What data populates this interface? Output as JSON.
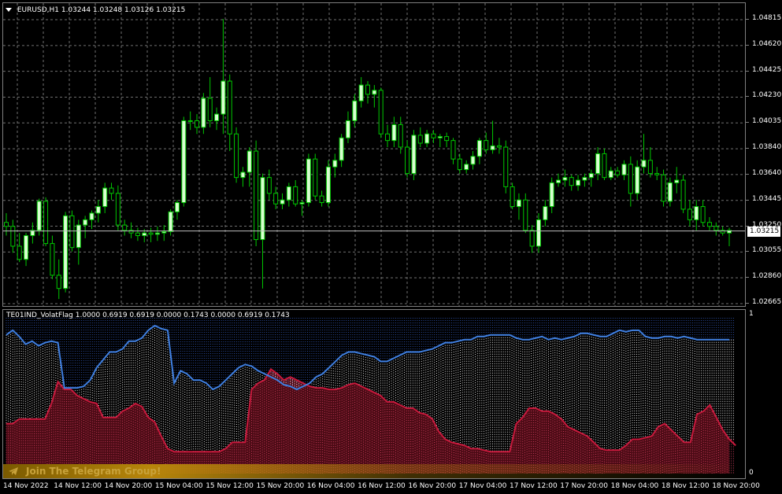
{
  "header": {
    "symbol_label": "EURUSD,H1  1.03244 1.03248 1.03126 1.03215",
    "arrow_icon": "triangle-down-icon"
  },
  "indicator": {
    "label": "TE01IND_VolatFlag 1.0000 0.6919 0.6919 0.0000 0.1743 0.0000 0.6919 0.1743",
    "scale_top": "1",
    "scale_bottom": "0",
    "colors": {
      "upper_line": "#3f7fe0",
      "lower_line": "#c8193c",
      "lower_fill": "#4a0a14",
      "dots_upper": "#2a4a9a",
      "dots_lower": "#d04060"
    }
  },
  "price_axis": {
    "labels": [
      "1.04815",
      "1.04620",
      "1.04425",
      "1.04230",
      "1.04035",
      "1.03840",
      "1.03640",
      "1.03445",
      "1.03250",
      "1.03055",
      "1.02860",
      "1.02665"
    ],
    "current_price": "1.03215"
  },
  "time_axis": {
    "labels": [
      "14 Nov 2022",
      "14 Nov 12:00",
      "14 Nov 20:00",
      "15 Nov 04:00",
      "15 Nov 12:00",
      "15 Nov 20:00",
      "16 Nov 04:00",
      "16 Nov 12:00",
      "16 Nov 20:00",
      "17 Nov 04:00",
      "17 Nov 12:00",
      "17 Nov 20:00",
      "18 Nov 04:00",
      "18 Nov 12:00",
      "18 Nov 20:00"
    ]
  },
  "banner": {
    "text": "Join The Telegram Group!",
    "icon": "telegram-icon"
  },
  "colors": {
    "background": "#000000",
    "candle": "#00c800",
    "candle_bull_body": "#d8ffd0",
    "grid": "#6f6f6f"
  },
  "chart_data": [
    {
      "type": "candlestick",
      "symbol": "EURUSD,H1",
      "ylim": [
        1.02665,
        1.04815
      ],
      "bars": [
        [
          1.0328,
          1.0335,
          1.0318,
          1.0325
        ],
        [
          1.0325,
          1.033,
          1.0305,
          1.031
        ],
        [
          1.031,
          1.032,
          1.0298,
          1.03
        ],
        [
          1.03,
          1.032,
          1.0295,
          1.0318
        ],
        [
          1.0318,
          1.0328,
          1.0312,
          1.0322
        ],
        [
          1.0322,
          1.0346,
          1.0318,
          1.0344
        ],
        [
          1.0344,
          1.0347,
          1.031,
          1.0312
        ],
        [
          1.0312,
          1.0318,
          1.0285,
          1.0288
        ],
        [
          1.0288,
          1.03,
          1.027,
          1.0278
        ],
        [
          1.0278,
          1.0336,
          1.0275,
          1.0333
        ],
        [
          1.0333,
          1.0337,
          1.0306,
          1.0309
        ],
        [
          1.0309,
          1.033,
          1.0296,
          1.0326
        ],
        [
          1.0326,
          1.0333,
          1.0316,
          1.033
        ],
        [
          1.033,
          1.0337,
          1.0323,
          1.0335
        ],
        [
          1.0335,
          1.0345,
          1.0328,
          1.034
        ],
        [
          1.034,
          1.0358,
          1.0335,
          1.0354
        ],
        [
          1.0354,
          1.0358,
          1.0345,
          1.035
        ],
        [
          1.035,
          1.0356,
          1.0322,
          1.0326
        ],
        [
          1.0326,
          1.033,
          1.0318,
          1.0322
        ],
        [
          1.0322,
          1.0328,
          1.0316,
          1.032
        ],
        [
          1.032,
          1.0324,
          1.0314,
          1.0318
        ],
        [
          1.0318,
          1.0323,
          1.0313,
          1.032
        ],
        [
          1.032,
          1.0324,
          1.0313,
          1.0319
        ],
        [
          1.0319,
          1.0325,
          1.0314,
          1.032
        ],
        [
          1.032,
          1.0326,
          1.0314,
          1.0321
        ],
        [
          1.0321,
          1.0338,
          1.0318,
          1.0336
        ],
        [
          1.0336,
          1.0345,
          1.033,
          1.0343
        ],
        [
          1.0343,
          1.0408,
          1.034,
          1.0405
        ],
        [
          1.0405,
          1.0412,
          1.0398,
          1.0405
        ],
        [
          1.0405,
          1.041,
          1.0395,
          1.04
        ],
        [
          1.04,
          1.0426,
          1.0395,
          1.0422
        ],
        [
          1.0422,
          1.0438,
          1.04,
          1.0405
        ],
        [
          1.0405,
          1.0415,
          1.0398,
          1.041
        ],
        [
          1.041,
          1.0482,
          1.0395,
          1.0435
        ],
        [
          1.0435,
          1.044,
          1.0382,
          1.0395
        ],
        [
          1.0395,
          1.04,
          1.0358,
          1.0362
        ],
        [
          1.0362,
          1.037,
          1.0355,
          1.0366
        ],
        [
          1.0366,
          1.0385,
          1.0355,
          1.0382
        ],
        [
          1.0382,
          1.039,
          1.031,
          1.0315
        ],
        [
          1.0315,
          1.0365,
          1.0278,
          1.0362
        ],
        [
          1.0362,
          1.0368,
          1.0345,
          1.035
        ],
        [
          1.035,
          1.0355,
          1.0338,
          1.0342
        ],
        [
          1.0342,
          1.035,
          1.0338,
          1.0345
        ],
        [
          1.0345,
          1.0358,
          1.034,
          1.0355
        ],
        [
          1.0355,
          1.036,
          1.034,
          1.0342
        ],
        [
          1.0342,
          1.0345,
          1.0333,
          1.0343
        ],
        [
          1.0343,
          1.038,
          1.034,
          1.0376
        ],
        [
          1.0376,
          1.038,
          1.0345,
          1.0348
        ],
        [
          1.0348,
          1.0352,
          1.034,
          1.0343
        ],
        [
          1.0343,
          1.0375,
          1.034,
          1.037
        ],
        [
          1.037,
          1.038,
          1.0362,
          1.0375
        ],
        [
          1.0375,
          1.0395,
          1.037,
          1.0392
        ],
        [
          1.0392,
          1.0412,
          1.0388,
          1.0405
        ],
        [
          1.0405,
          1.0425,
          1.04,
          1.042
        ],
        [
          1.042,
          1.0438,
          1.0415,
          1.0432
        ],
        [
          1.0432,
          1.0435,
          1.0418,
          1.0425
        ],
        [
          1.0425,
          1.0432,
          1.0415,
          1.0428
        ],
        [
          1.0428,
          1.043,
          1.0392,
          1.0395
        ],
        [
          1.0395,
          1.0402,
          1.0385,
          1.039
        ],
        [
          1.039,
          1.0408,
          1.0385,
          1.0402
        ],
        [
          1.0402,
          1.0408,
          1.038,
          1.0385
        ],
        [
          1.0385,
          1.039,
          1.0362,
          1.0365
        ],
        [
          1.0365,
          1.0398,
          1.036,
          1.0394
        ],
        [
          1.0394,
          1.04,
          1.0385,
          1.0388
        ],
        [
          1.0388,
          1.0398,
          1.0385,
          1.0395
        ],
        [
          1.0395,
          1.0398,
          1.0388,
          1.0392
        ],
        [
          1.0392,
          1.0395,
          1.0385,
          1.0393
        ],
        [
          1.0393,
          1.0396,
          1.0385,
          1.039
        ],
        [
          1.039,
          1.0392,
          1.0372,
          1.0376
        ],
        [
          1.0376,
          1.038,
          1.0365,
          1.0368
        ],
        [
          1.0368,
          1.0375,
          1.0365,
          1.0372
        ],
        [
          1.0372,
          1.0382,
          1.0368,
          1.0378
        ],
        [
          1.0378,
          1.0392,
          1.0372,
          1.039
        ],
        [
          1.039,
          1.0396,
          1.038,
          1.0383
        ],
        [
          1.0383,
          1.0405,
          1.038,
          1.0386
        ],
        [
          1.0386,
          1.0392,
          1.038,
          1.0385
        ],
        [
          1.0385,
          1.039,
          1.035,
          1.0355
        ],
        [
          1.0355,
          1.0358,
          1.0338,
          1.034
        ],
        [
          1.034,
          1.035,
          1.033,
          1.0345
        ],
        [
          1.0345,
          1.035,
          1.032,
          1.0322
        ],
        [
          1.0322,
          1.0326,
          1.0305,
          1.031
        ],
        [
          1.031,
          1.0335,
          1.0305,
          1.033
        ],
        [
          1.033,
          1.0345,
          1.0325,
          1.034
        ],
        [
          1.034,
          1.0362,
          1.0335,
          1.0358
        ],
        [
          1.0358,
          1.0365,
          1.0355,
          1.036
        ],
        [
          1.036,
          1.0368,
          1.0355,
          1.0362
        ],
        [
          1.0362,
          1.0364,
          1.0352,
          1.0356
        ],
        [
          1.0356,
          1.0364,
          1.0352,
          1.036
        ],
        [
          1.036,
          1.0365,
          1.0355,
          1.0362
        ],
        [
          1.0362,
          1.0368,
          1.0355,
          1.0365
        ],
        [
          1.0365,
          1.0385,
          1.036,
          1.038
        ],
        [
          1.038,
          1.0384,
          1.036,
          1.0362
        ],
        [
          1.0362,
          1.037,
          1.036,
          1.0367
        ],
        [
          1.0367,
          1.037,
          1.0362,
          1.0364
        ],
        [
          1.0364,
          1.0375,
          1.036,
          1.0372
        ],
        [
          1.0372,
          1.0378,
          1.034,
          1.035
        ],
        [
          1.035,
          1.0375,
          1.0345,
          1.037
        ],
        [
          1.037,
          1.0395,
          1.0365,
          1.0375
        ],
        [
          1.0375,
          1.0385,
          1.0362,
          1.0365
        ],
        [
          1.0365,
          1.037,
          1.036,
          1.0364
        ],
        [
          1.0364,
          1.0368,
          1.034,
          1.0344
        ],
        [
          1.0344,
          1.0362,
          1.034,
          1.0358
        ],
        [
          1.0358,
          1.037,
          1.035,
          1.036
        ],
        [
          1.036,
          1.0364,
          1.0335,
          1.0338
        ],
        [
          1.0338,
          1.0345,
          1.0325,
          1.033
        ],
        [
          1.033,
          1.0345,
          1.0322,
          1.034
        ],
        [
          1.034,
          1.0345,
          1.0325,
          1.0328
        ],
        [
          1.0328,
          1.0332,
          1.0322,
          1.0325
        ],
        [
          1.0325,
          1.0328,
          1.0318,
          1.0322
        ],
        [
          1.0322,
          1.0325,
          1.0318,
          1.032
        ],
        [
          1.032,
          1.0324,
          1.031,
          1.0322
        ]
      ]
    },
    {
      "type": "line",
      "name": "TE01IND_VolatFlag",
      "ylim": [
        0,
        1
      ],
      "series": [
        {
          "values": [
            0.89,
            0.92,
            0.88,
            0.83,
            0.85,
            0.82,
            0.84,
            0.85,
            0.84,
            0.55,
            0.55,
            0.55,
            0.56,
            0.6,
            0.68,
            0.73,
            0.78,
            0.78,
            0.8,
            0.85,
            0.85,
            0.87,
            0.92,
            0.95,
            0.93,
            0.92,
            0.58,
            0.66,
            0.64,
            0.6,
            0.6,
            0.58,
            0.54,
            0.56,
            0.6,
            0.64,
            0.68,
            0.7,
            0.69,
            0.66,
            0.64,
            0.62,
            0.6,
            0.57,
            0.56,
            0.54,
            0.56,
            0.58,
            0.62,
            0.64,
            0.68,
            0.72,
            0.76,
            0.78,
            0.78,
            0.77,
            0.76,
            0.75,
            0.72,
            0.72,
            0.74,
            0.76,
            0.78,
            0.78,
            0.78,
            0.79,
            0.8,
            0.82,
            0.84,
            0.84,
            0.85,
            0.86,
            0.86,
            0.88,
            0.88,
            0.89,
            0.89,
            0.89,
            0.89,
            0.87,
            0.86,
            0.86,
            0.87,
            0.88,
            0.86,
            0.87,
            0.86,
            0.87,
            0.88,
            0.9,
            0.9,
            0.89,
            0.88,
            0.88,
            0.9,
            0.92,
            0.91,
            0.92,
            0.92,
            0.88,
            0.87,
            0.87,
            0.88,
            0.88,
            0.87,
            0.88,
            0.87,
            0.86,
            0.86,
            0.86,
            0.86,
            0.86,
            0.86
          ]
        },
        {
          "values": [
            0.32,
            0.32,
            0.35,
            0.35,
            0.35,
            0.35,
            0.35,
            0.45,
            0.59,
            0.54,
            0.54,
            0.5,
            0.48,
            0.46,
            0.45,
            0.36,
            0.36,
            0.36,
            0.4,
            0.42,
            0.45,
            0.43,
            0.36,
            0.33,
            0.24,
            0.16,
            0.14,
            0.14,
            0.14,
            0.14,
            0.14,
            0.14,
            0.14,
            0.14,
            0.16,
            0.2,
            0.2,
            0.2,
            0.54,
            0.58,
            0.6,
            0.67,
            0.64,
            0.6,
            0.62,
            0.6,
            0.58,
            0.56,
            0.55,
            0.55,
            0.54,
            0.54,
            0.55,
            0.57,
            0.58,
            0.56,
            0.54,
            0.52,
            0.5,
            0.46,
            0.46,
            0.44,
            0.42,
            0.42,
            0.39,
            0.38,
            0.35,
            0.27,
            0.22,
            0.2,
            0.19,
            0.18,
            0.16,
            0.16,
            0.15,
            0.14,
            0.14,
            0.14,
            0.14,
            0.32,
            0.36,
            0.42,
            0.42,
            0.4,
            0.4,
            0.38,
            0.35,
            0.3,
            0.28,
            0.26,
            0.24,
            0.2,
            0.16,
            0.15,
            0.15,
            0.15,
            0.18,
            0.22,
            0.22,
            0.23,
            0.24,
            0.3,
            0.32,
            0.28,
            0.24,
            0.2,
            0.2,
            0.38,
            0.4,
            0.44,
            0.36,
            0.28,
            0.22,
            0.18
          ]
        }
      ]
    }
  ]
}
